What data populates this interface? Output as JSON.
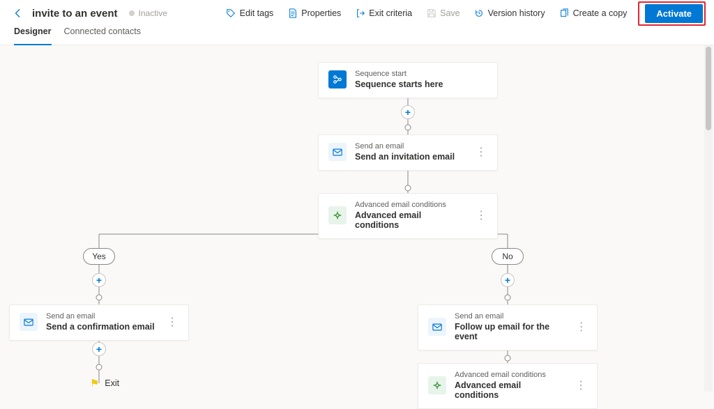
{
  "header": {
    "title": "invite to an event",
    "status": "Inactive"
  },
  "toolbar": {
    "edit_tags": "Edit tags",
    "properties": "Properties",
    "exit_criteria": "Exit criteria",
    "save": "Save",
    "version_history": "Version history",
    "create_copy": "Create a copy",
    "activate": "Activate"
  },
  "tabs": {
    "designer": "Designer",
    "connected": "Connected contacts"
  },
  "nodes": {
    "start": {
      "sub": "Sequence start",
      "main": "Sequence starts here"
    },
    "email1": {
      "sub": "Send an email",
      "main": "Send an invitation email"
    },
    "cond1": {
      "sub": "Advanced email conditions",
      "main": "Advanced email conditions"
    },
    "emailY": {
      "sub": "Send an email",
      "main": "Send a confirmation email"
    },
    "emailN": {
      "sub": "Send an email",
      "main": "Follow up email for the event"
    },
    "cond2": {
      "sub": "Advanced email conditions",
      "main": "Advanced email conditions"
    }
  },
  "branch": {
    "yes": "Yes",
    "no": "No"
  },
  "exit_label": "Exit"
}
